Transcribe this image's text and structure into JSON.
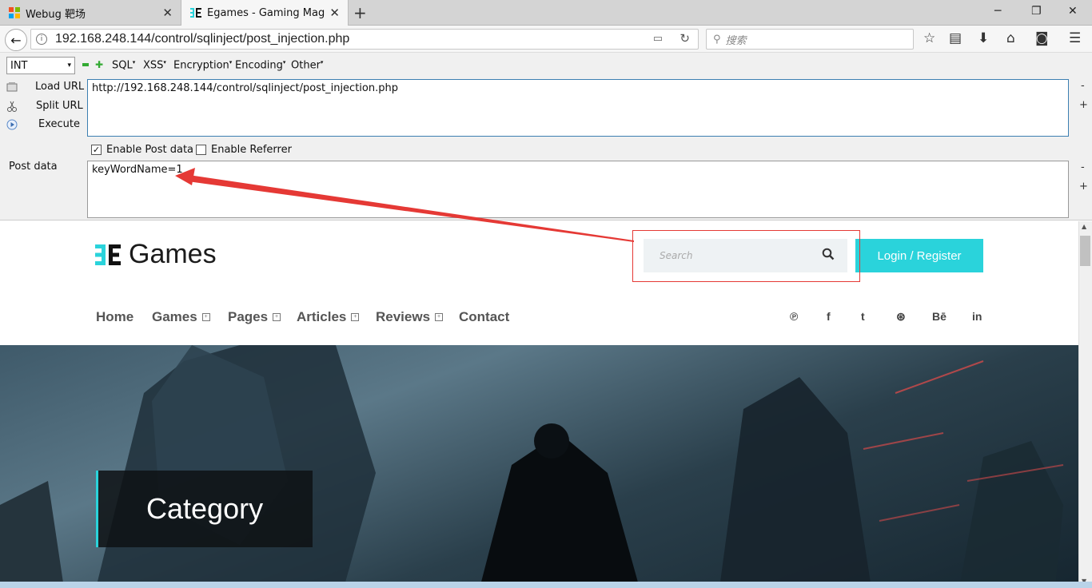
{
  "browser": {
    "tabs": [
      {
        "title": "Webug 靶场",
        "active": false
      },
      {
        "title": "Egames - Gaming Maga...",
        "active": true
      }
    ],
    "new_tab": "+",
    "window_controls": [
      "─",
      "❐",
      "✕"
    ],
    "url": "192.168.248.144/control/sqlinject/post_injection.php",
    "search_placeholder": "搜索"
  },
  "hackbar": {
    "type_select": "INT",
    "menus": [
      "SQL",
      "XSS",
      "Encryption",
      "Encoding",
      "Other"
    ],
    "actions": [
      "Load URL",
      "Split URL",
      "Execute"
    ],
    "url_value": "http://192.168.248.144/control/sqlinject/post_injection.php",
    "enable_post_label": "Enable Post data",
    "enable_post_checked": true,
    "enable_referrer_label": "Enable Referrer",
    "enable_referrer_checked": false,
    "post_label": "Post data",
    "post_value": "keyWordName=1",
    "minus": "-",
    "plus": "+"
  },
  "site": {
    "logo_text": "Games",
    "search_placeholder": "Search",
    "login_label": "Login / Register",
    "nav": [
      {
        "label": "Home",
        "dropdown": false
      },
      {
        "label": "Games",
        "dropdown": true
      },
      {
        "label": "Pages",
        "dropdown": true
      },
      {
        "label": "Articles",
        "dropdown": true
      },
      {
        "label": "Reviews",
        "dropdown": true
      },
      {
        "label": "Contact",
        "dropdown": false
      }
    ],
    "social": [
      "pinterest-icon",
      "facebook-icon",
      "twitter-icon",
      "dribbble-icon",
      "behance-icon",
      "linkedin-icon"
    ],
    "social_glyphs": [
      "℗",
      "f",
      "t",
      "⊛",
      "Bē",
      "in"
    ],
    "hero_title": "Category",
    "accent_color": "#2ad3db",
    "annotation_color": "#e53935"
  }
}
